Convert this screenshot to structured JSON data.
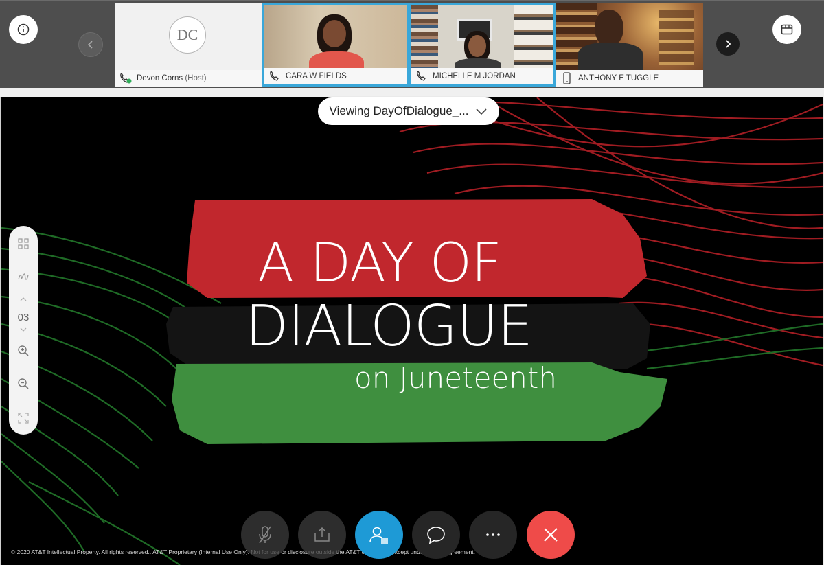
{
  "participants": [
    {
      "initials": "DC",
      "name": "Devon Corns",
      "role": "(Host)",
      "device": "phone-icon"
    },
    {
      "name": "CARA W FIELDS",
      "device": "phone-icon"
    },
    {
      "name": "MICHELLE M JORDAN",
      "device": "phone-icon"
    },
    {
      "name": "ANTHONY E TUGGLE",
      "device": "mobile-icon"
    }
  ],
  "viewing": {
    "label": "Viewing DayOfDialogue_..."
  },
  "slide": {
    "line1": "A DAY OF",
    "line2": "DIALOGUE",
    "line3": "on Juneteenth"
  },
  "toolbar": {
    "page": "03"
  },
  "footer": {
    "notice": "© 2020 AT&T Intellectual Property. All rights reserved.. AT&T Proprietary (Internal Use Only). Not for use or disclosure outside the AT&T companies except under written agreement."
  },
  "colors": {
    "accent": "#1e9ad6",
    "end_call": "#ef4b49",
    "slide_red": "#c1272d",
    "slide_green": "#3f8f3f",
    "active_border": "#3aa7d9"
  }
}
